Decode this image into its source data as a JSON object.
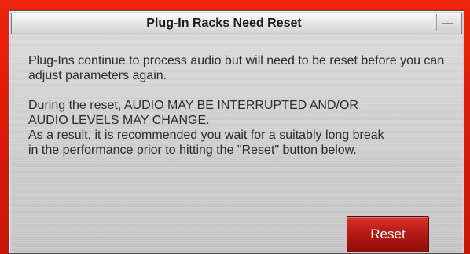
{
  "dialog": {
    "title": "Plug-In Racks Need Reset",
    "message_1": "Plug-Ins continue to process audio but will need to be reset before you can adjust parameters again.",
    "message_2_lines": [
      "During the reset, AUDIO MAY BE INTERRUPTED AND/OR",
      "AUDIO LEVELS MAY CHANGE.",
      "As a result, it is recommended you wait for a suitably long break",
      "in the performance prior to hitting the \"Reset\" button below."
    ],
    "reset_label": "Reset",
    "collapse_icon": "minus-icon"
  },
  "colors": {
    "frame_red": "#dc1c0a",
    "button_red": "#b81a14",
    "panel_gray": "#cfcfcf"
  }
}
